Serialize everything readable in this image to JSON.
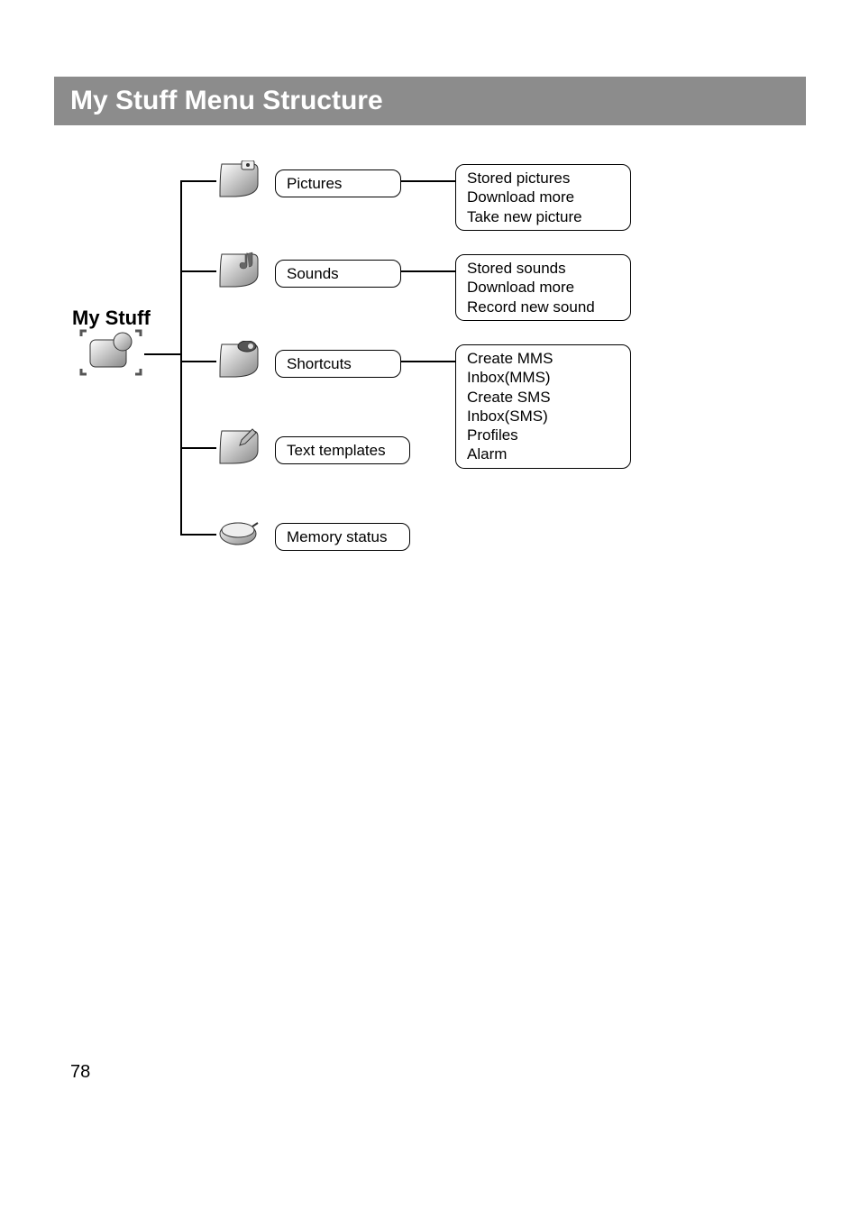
{
  "header": {
    "title": "My Stuff Menu Structure"
  },
  "page_number": "78",
  "diagram": {
    "root": {
      "label": "My Stuff"
    },
    "nodes": {
      "pictures": {
        "label": "Pictures"
      },
      "sounds": {
        "label": "Sounds"
      },
      "shortcuts": {
        "label": "Shortcuts"
      },
      "text_templates": {
        "label": "Text templates"
      },
      "memory_status": {
        "label": "Memory status"
      }
    },
    "subnodes": {
      "pictures": {
        "lines": [
          "Stored pictures",
          "Download more",
          "Take new picture"
        ]
      },
      "sounds": {
        "lines": [
          "Stored sounds",
          "Download more",
          "Record new sound"
        ]
      },
      "shortcuts": {
        "lines": [
          "Create MMS",
          "Inbox(MMS)",
          "Create SMS",
          "Inbox(SMS)",
          "Profiles",
          "Alarm"
        ]
      }
    }
  }
}
